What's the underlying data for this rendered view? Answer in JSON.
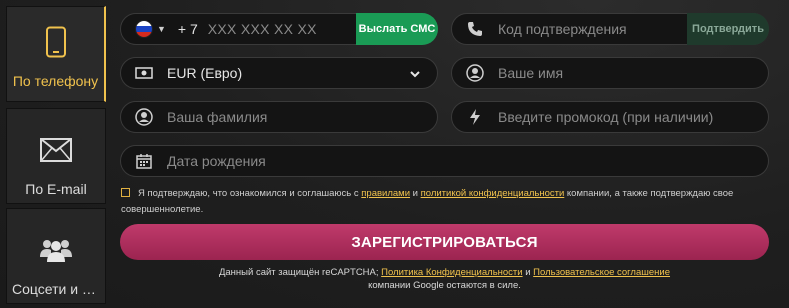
{
  "sidebar": {
    "tabs": [
      {
        "label": "По телефону",
        "icon": "smartphone-icon",
        "active": true
      },
      {
        "label": "По E-mail",
        "icon": "envelope-icon",
        "active": false
      },
      {
        "label": "Соцсети и м...",
        "icon": "users-icon",
        "active": false
      }
    ]
  },
  "form": {
    "phone": {
      "country_code": "+ 7",
      "placeholder": "XXX XXX XX XX",
      "flag": "russia-flag-icon"
    },
    "send_sms_label": "Выслать СМС",
    "code": {
      "placeholder": "Код подтверждения",
      "button_label": "Подтвердить"
    },
    "currency": {
      "value": "EUR (Евро)"
    },
    "name": {
      "placeholder": "Ваше имя"
    },
    "surname": {
      "placeholder": "Ваша фамилия"
    },
    "promo": {
      "placeholder": "Введите промокод (при наличии)"
    },
    "birthdate": {
      "placeholder": "Дата рождения"
    },
    "agreement": {
      "text_1": "Я подтверждаю, что ознакомился и соглашаюсь с",
      "link_rules": "правилами",
      "text_2": "и",
      "link_privacy": "политикой конфиденциальности",
      "text_3": "компании, а также подтверждаю свое совершеннолетие."
    },
    "register_label": "ЗАРЕГИСТРИРОВАТЬСЯ",
    "captcha": {
      "text_1": "Данный сайт защищён reCAPTCHA;",
      "link_privacy": "Политика Конфиденциальности",
      "text_2": "и",
      "link_terms": "Пользовательское соглашение",
      "text_3": "компании Google остаются в силе."
    }
  },
  "colors": {
    "accent": "#f0c24d",
    "sms_button": "#1a9b55",
    "register_button": "#b1305f",
    "background": "#1d1d1d"
  }
}
